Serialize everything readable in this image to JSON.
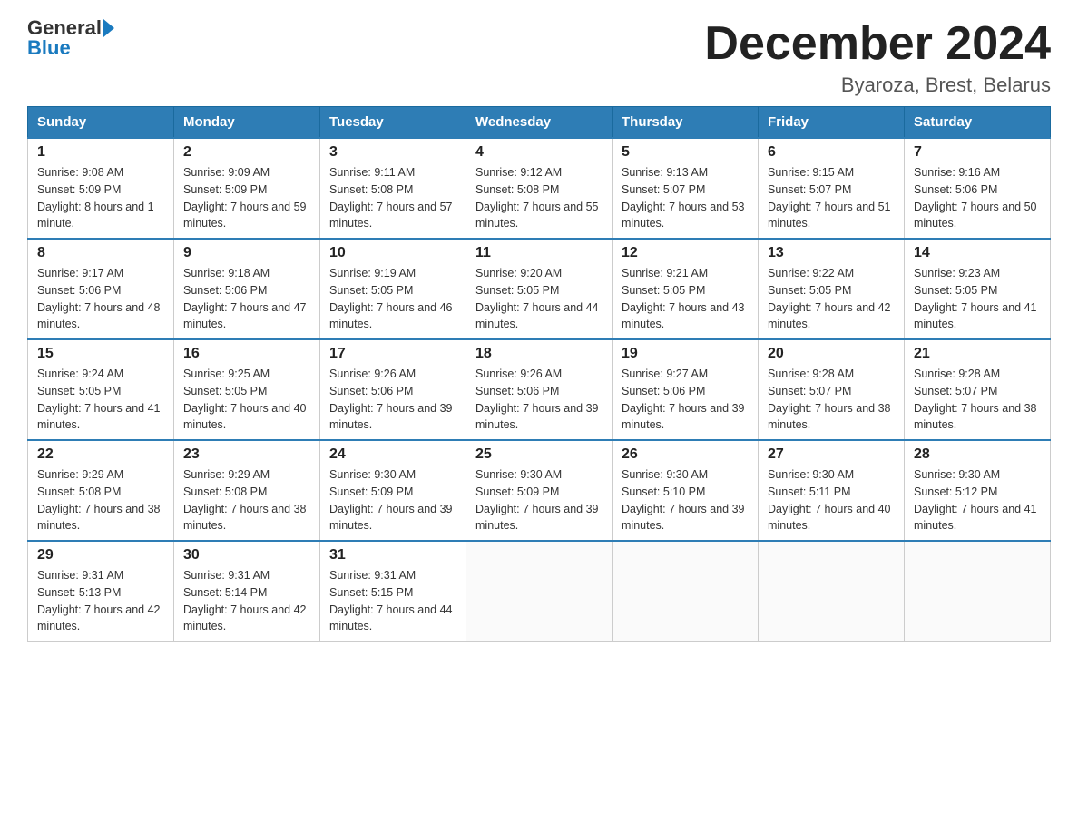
{
  "logo": {
    "text_general": "General",
    "text_blue": "Blue"
  },
  "header": {
    "month": "December 2024",
    "location": "Byaroza, Brest, Belarus"
  },
  "days_of_week": [
    "Sunday",
    "Monday",
    "Tuesday",
    "Wednesday",
    "Thursday",
    "Friday",
    "Saturday"
  ],
  "weeks": [
    [
      {
        "day": "1",
        "sunrise": "9:08 AM",
        "sunset": "5:09 PM",
        "daylight": "8 hours and 1 minute."
      },
      {
        "day": "2",
        "sunrise": "9:09 AM",
        "sunset": "5:09 PM",
        "daylight": "7 hours and 59 minutes."
      },
      {
        "day": "3",
        "sunrise": "9:11 AM",
        "sunset": "5:08 PM",
        "daylight": "7 hours and 57 minutes."
      },
      {
        "day": "4",
        "sunrise": "9:12 AM",
        "sunset": "5:08 PM",
        "daylight": "7 hours and 55 minutes."
      },
      {
        "day": "5",
        "sunrise": "9:13 AM",
        "sunset": "5:07 PM",
        "daylight": "7 hours and 53 minutes."
      },
      {
        "day": "6",
        "sunrise": "9:15 AM",
        "sunset": "5:07 PM",
        "daylight": "7 hours and 51 minutes."
      },
      {
        "day": "7",
        "sunrise": "9:16 AM",
        "sunset": "5:06 PM",
        "daylight": "7 hours and 50 minutes."
      }
    ],
    [
      {
        "day": "8",
        "sunrise": "9:17 AM",
        "sunset": "5:06 PM",
        "daylight": "7 hours and 48 minutes."
      },
      {
        "day": "9",
        "sunrise": "9:18 AM",
        "sunset": "5:06 PM",
        "daylight": "7 hours and 47 minutes."
      },
      {
        "day": "10",
        "sunrise": "9:19 AM",
        "sunset": "5:05 PM",
        "daylight": "7 hours and 46 minutes."
      },
      {
        "day": "11",
        "sunrise": "9:20 AM",
        "sunset": "5:05 PM",
        "daylight": "7 hours and 44 minutes."
      },
      {
        "day": "12",
        "sunrise": "9:21 AM",
        "sunset": "5:05 PM",
        "daylight": "7 hours and 43 minutes."
      },
      {
        "day": "13",
        "sunrise": "9:22 AM",
        "sunset": "5:05 PM",
        "daylight": "7 hours and 42 minutes."
      },
      {
        "day": "14",
        "sunrise": "9:23 AM",
        "sunset": "5:05 PM",
        "daylight": "7 hours and 41 minutes."
      }
    ],
    [
      {
        "day": "15",
        "sunrise": "9:24 AM",
        "sunset": "5:05 PM",
        "daylight": "7 hours and 41 minutes."
      },
      {
        "day": "16",
        "sunrise": "9:25 AM",
        "sunset": "5:05 PM",
        "daylight": "7 hours and 40 minutes."
      },
      {
        "day": "17",
        "sunrise": "9:26 AM",
        "sunset": "5:06 PM",
        "daylight": "7 hours and 39 minutes."
      },
      {
        "day": "18",
        "sunrise": "9:26 AM",
        "sunset": "5:06 PM",
        "daylight": "7 hours and 39 minutes."
      },
      {
        "day": "19",
        "sunrise": "9:27 AM",
        "sunset": "5:06 PM",
        "daylight": "7 hours and 39 minutes."
      },
      {
        "day": "20",
        "sunrise": "9:28 AM",
        "sunset": "5:07 PM",
        "daylight": "7 hours and 38 minutes."
      },
      {
        "day": "21",
        "sunrise": "9:28 AM",
        "sunset": "5:07 PM",
        "daylight": "7 hours and 38 minutes."
      }
    ],
    [
      {
        "day": "22",
        "sunrise": "9:29 AM",
        "sunset": "5:08 PM",
        "daylight": "7 hours and 38 minutes."
      },
      {
        "day": "23",
        "sunrise": "9:29 AM",
        "sunset": "5:08 PM",
        "daylight": "7 hours and 38 minutes."
      },
      {
        "day": "24",
        "sunrise": "9:30 AM",
        "sunset": "5:09 PM",
        "daylight": "7 hours and 39 minutes."
      },
      {
        "day": "25",
        "sunrise": "9:30 AM",
        "sunset": "5:09 PM",
        "daylight": "7 hours and 39 minutes."
      },
      {
        "day": "26",
        "sunrise": "9:30 AM",
        "sunset": "5:10 PM",
        "daylight": "7 hours and 39 minutes."
      },
      {
        "day": "27",
        "sunrise": "9:30 AM",
        "sunset": "5:11 PM",
        "daylight": "7 hours and 40 minutes."
      },
      {
        "day": "28",
        "sunrise": "9:30 AM",
        "sunset": "5:12 PM",
        "daylight": "7 hours and 41 minutes."
      }
    ],
    [
      {
        "day": "29",
        "sunrise": "9:31 AM",
        "sunset": "5:13 PM",
        "daylight": "7 hours and 42 minutes."
      },
      {
        "day": "30",
        "sunrise": "9:31 AM",
        "sunset": "5:14 PM",
        "daylight": "7 hours and 42 minutes."
      },
      {
        "day": "31",
        "sunrise": "9:31 AM",
        "sunset": "5:15 PM",
        "daylight": "7 hours and 44 minutes."
      },
      null,
      null,
      null,
      null
    ]
  ]
}
